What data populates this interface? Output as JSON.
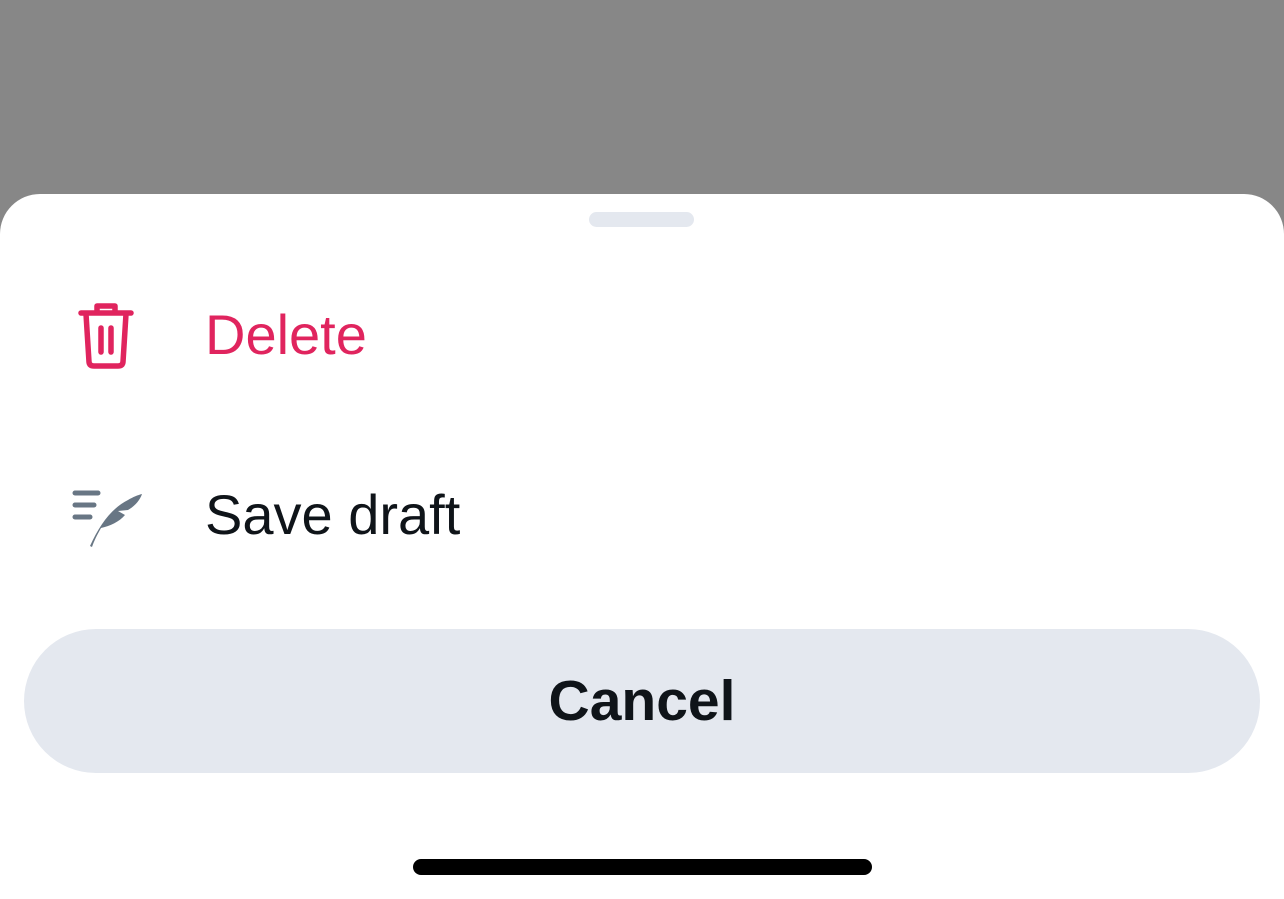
{
  "colors": {
    "backdrop": "#878787",
    "sheet": "#ffffff",
    "danger": "#e0245e",
    "text": "#0f1419",
    "muted_icon": "#687684",
    "cancel_bg": "#e4e8ef"
  },
  "sheet": {
    "actions": [
      {
        "label": "Delete",
        "icon": "trash-icon"
      },
      {
        "label": "Save draft",
        "icon": "quill-icon"
      }
    ],
    "cancel_label": "Cancel"
  }
}
